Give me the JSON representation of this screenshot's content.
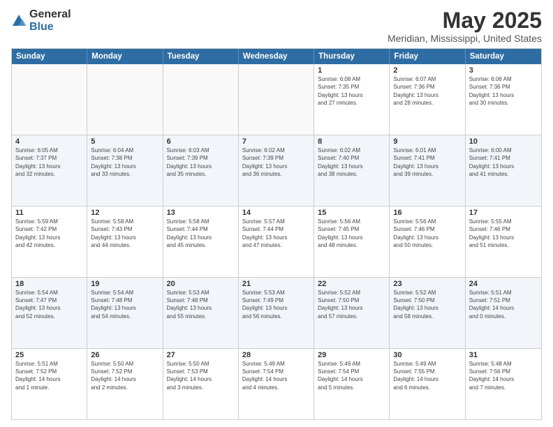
{
  "logo": {
    "general": "General",
    "blue": "Blue"
  },
  "title": "May 2025",
  "subtitle": "Meridian, Mississippi, United States",
  "days_of_week": [
    "Sunday",
    "Monday",
    "Tuesday",
    "Wednesday",
    "Thursday",
    "Friday",
    "Saturday"
  ],
  "weeks": [
    [
      {
        "day": "",
        "info": ""
      },
      {
        "day": "",
        "info": ""
      },
      {
        "day": "",
        "info": ""
      },
      {
        "day": "",
        "info": ""
      },
      {
        "day": "1",
        "info": "Sunrise: 6:08 AM\nSunset: 7:35 PM\nDaylight: 13 hours\nand 27 minutes."
      },
      {
        "day": "2",
        "info": "Sunrise: 6:07 AM\nSunset: 7:36 PM\nDaylight: 13 hours\nand 28 minutes."
      },
      {
        "day": "3",
        "info": "Sunrise: 6:06 AM\nSunset: 7:36 PM\nDaylight: 13 hours\nand 30 minutes."
      }
    ],
    [
      {
        "day": "4",
        "info": "Sunrise: 6:05 AM\nSunset: 7:37 PM\nDaylight: 13 hours\nand 32 minutes."
      },
      {
        "day": "5",
        "info": "Sunrise: 6:04 AM\nSunset: 7:38 PM\nDaylight: 13 hours\nand 33 minutes."
      },
      {
        "day": "6",
        "info": "Sunrise: 6:03 AM\nSunset: 7:39 PM\nDaylight: 13 hours\nand 35 minutes."
      },
      {
        "day": "7",
        "info": "Sunrise: 6:02 AM\nSunset: 7:39 PM\nDaylight: 13 hours\nand 36 minutes."
      },
      {
        "day": "8",
        "info": "Sunrise: 6:02 AM\nSunset: 7:40 PM\nDaylight: 13 hours\nand 38 minutes."
      },
      {
        "day": "9",
        "info": "Sunrise: 6:01 AM\nSunset: 7:41 PM\nDaylight: 13 hours\nand 39 minutes."
      },
      {
        "day": "10",
        "info": "Sunrise: 6:00 AM\nSunset: 7:41 PM\nDaylight: 13 hours\nand 41 minutes."
      }
    ],
    [
      {
        "day": "11",
        "info": "Sunrise: 5:59 AM\nSunset: 7:42 PM\nDaylight: 13 hours\nand 42 minutes."
      },
      {
        "day": "12",
        "info": "Sunrise: 5:58 AM\nSunset: 7:43 PM\nDaylight: 13 hours\nand 44 minutes."
      },
      {
        "day": "13",
        "info": "Sunrise: 5:58 AM\nSunset: 7:44 PM\nDaylight: 13 hours\nand 45 minutes."
      },
      {
        "day": "14",
        "info": "Sunrise: 5:57 AM\nSunset: 7:44 PM\nDaylight: 13 hours\nand 47 minutes."
      },
      {
        "day": "15",
        "info": "Sunrise: 5:56 AM\nSunset: 7:45 PM\nDaylight: 13 hours\nand 48 minutes."
      },
      {
        "day": "16",
        "info": "Sunrise: 5:56 AM\nSunset: 7:46 PM\nDaylight: 13 hours\nand 50 minutes."
      },
      {
        "day": "17",
        "info": "Sunrise: 5:55 AM\nSunset: 7:46 PM\nDaylight: 13 hours\nand 51 minutes."
      }
    ],
    [
      {
        "day": "18",
        "info": "Sunrise: 5:54 AM\nSunset: 7:47 PM\nDaylight: 13 hours\nand 52 minutes."
      },
      {
        "day": "19",
        "info": "Sunrise: 5:54 AM\nSunset: 7:48 PM\nDaylight: 13 hours\nand 54 minutes."
      },
      {
        "day": "20",
        "info": "Sunrise: 5:53 AM\nSunset: 7:48 PM\nDaylight: 13 hours\nand 55 minutes."
      },
      {
        "day": "21",
        "info": "Sunrise: 5:53 AM\nSunset: 7:49 PM\nDaylight: 13 hours\nand 56 minutes."
      },
      {
        "day": "22",
        "info": "Sunrise: 5:52 AM\nSunset: 7:50 PM\nDaylight: 13 hours\nand 57 minutes."
      },
      {
        "day": "23",
        "info": "Sunrise: 5:52 AM\nSunset: 7:50 PM\nDaylight: 13 hours\nand 58 minutes."
      },
      {
        "day": "24",
        "info": "Sunrise: 5:51 AM\nSunset: 7:51 PM\nDaylight: 14 hours\nand 0 minutes."
      }
    ],
    [
      {
        "day": "25",
        "info": "Sunrise: 5:51 AM\nSunset: 7:52 PM\nDaylight: 14 hours\nand 1 minute."
      },
      {
        "day": "26",
        "info": "Sunrise: 5:50 AM\nSunset: 7:52 PM\nDaylight: 14 hours\nand 2 minutes."
      },
      {
        "day": "27",
        "info": "Sunrise: 5:50 AM\nSunset: 7:53 PM\nDaylight: 14 hours\nand 3 minutes."
      },
      {
        "day": "28",
        "info": "Sunrise: 5:49 AM\nSunset: 7:54 PM\nDaylight: 14 hours\nand 4 minutes."
      },
      {
        "day": "29",
        "info": "Sunrise: 5:49 AM\nSunset: 7:54 PM\nDaylight: 14 hours\nand 5 minutes."
      },
      {
        "day": "30",
        "info": "Sunrise: 5:49 AM\nSunset: 7:55 PM\nDaylight: 14 hours\nand 6 minutes."
      },
      {
        "day": "31",
        "info": "Sunrise: 5:48 AM\nSunset: 7:56 PM\nDaylight: 14 hours\nand 7 minutes."
      }
    ]
  ],
  "alt_rows": [
    1,
    3
  ],
  "colors": {
    "header_bg": "#2e6da4",
    "alt_row_bg": "#e8f0f8",
    "border": "#ccc"
  }
}
